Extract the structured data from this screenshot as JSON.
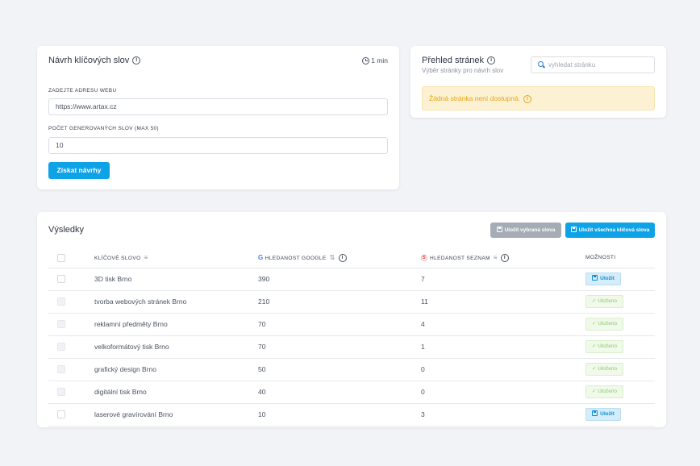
{
  "keyword_card": {
    "title": "Návrh klíčových slov",
    "time": "1 min",
    "url_label": "ZADEJTE ADRESU WEBU",
    "url_value": "https://www.artax.cz",
    "count_label": "POČET GENEROVANÝCH SLOV (MAX 50)",
    "count_value": "10",
    "submit_label": "Získat návrhy"
  },
  "pages_card": {
    "title": "Přehled stránek",
    "subtitle": "Výběr stránky pro návrh slov",
    "search_placeholder": "vyhledat stránku",
    "warning": "Žádná stránka není dostupná."
  },
  "results": {
    "title": "Výsledky",
    "save_selected_label": "Uložit vybraná slova",
    "save_all_label": "Uložit všechna klíčová slova",
    "columns": {
      "keyword": "KLÍČOVÉ SLOVO",
      "google": "HLEDANOST GOOGLE",
      "seznam": "HLEDANOST SEZNAM",
      "options": "MOŽNOSTI"
    },
    "save_label": "Uložit",
    "saved_label": "Uloženo",
    "rows": [
      {
        "keyword": "3D tisk Brno",
        "google": "390",
        "seznam": "7",
        "status": "save"
      },
      {
        "keyword": "tvorba webových stránek Brno",
        "google": "210",
        "seznam": "11",
        "status": "saved"
      },
      {
        "keyword": "reklamní předměty Brno",
        "google": "70",
        "seznam": "4",
        "status": "saved"
      },
      {
        "keyword": "velkoformátový tisk Brno",
        "google": "70",
        "seznam": "1",
        "status": "saved"
      },
      {
        "keyword": "grafický design Brno",
        "google": "50",
        "seznam": "0",
        "status": "saved"
      },
      {
        "keyword": "digitální tisk Brno",
        "google": "40",
        "seznam": "0",
        "status": "saved"
      },
      {
        "keyword": "laserové gravírování Brno",
        "google": "10",
        "seznam": "3",
        "status": "save"
      }
    ]
  },
  "colors": {
    "primary": "#0ea2e7",
    "warning_text": "#e3a713",
    "saved_text": "#88cc6a"
  }
}
